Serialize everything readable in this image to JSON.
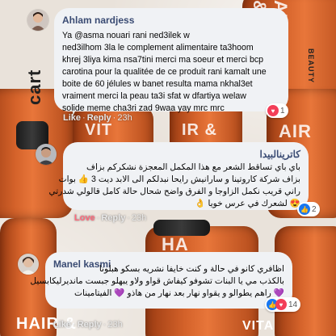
{
  "background": {
    "labels": [
      "AIR &",
      "VIT",
      "cart",
      "IR &",
      "AIR",
      "HA",
      "HAIR &",
      "VITA",
      "BEAUTY"
    ]
  },
  "comments": [
    {
      "author": "Ahlam nardjess",
      "direction": "ltr",
      "lines": [
        "Ya @asma nouari rani ned3ilek w",
        "ned3ilhom 3la le complement alimentaire ta3hoom",
        "khrej 3liya kima nsa7tini merci ma soeur et merci bcp",
        "carotina pour la qualitée de ce produit rani kamalt une",
        "boite de 60 jélules w banet resulta mama nkhal3et",
        "vraiment merci la peau ta3i sfat w dfartiya welaw",
        "solide meme cha3ri zad 9waa yay mrc mrc"
      ],
      "action_label": "Like",
      "reply_label": "Reply",
      "time": "23h",
      "reaction_count": "1",
      "reaction_color": "#f33e58"
    },
    {
      "author": "كاترينالبيدا",
      "direction": "rtl",
      "lines": [
        "باي باي تساقط الشعر مع هذا المكمل المعجزة نشكركم بزاف",
        "بزاف شركة كاروتينا و سارانيش رايحا نبدلكم الى الابد ديت 3 👍 بوات",
        "راني قريب نكمل الزاوجا و الفرق واضح شحال حالة كامل قالولي شدرتي",
        "😍 لشعرك في عرس خويا 👌"
      ],
      "action_label": "Love",
      "reply_label": "Reply",
      "time": "23h",
      "reaction_count": "2",
      "reaction_color": "#1877f2"
    },
    {
      "author": "Manel kasmi",
      "direction": "rtl",
      "lines": [
        "اظافري كانو في حالة و كنت خايفا نشريه بسكو هبلونا",
        "بالكذب مي يا البنات تشوفو كيفاش قواو ولاو يبهلو جبست مانديرليكابسيل",
        "💜 راهم يطوالو و يقواو نهار بعد نهار من هاذو 💜 الفيتامينات"
      ],
      "action_label": "Like",
      "reply_label": "Reply",
      "time": "23h",
      "reaction_count": "14",
      "reaction_color": "#1877f2"
    }
  ]
}
